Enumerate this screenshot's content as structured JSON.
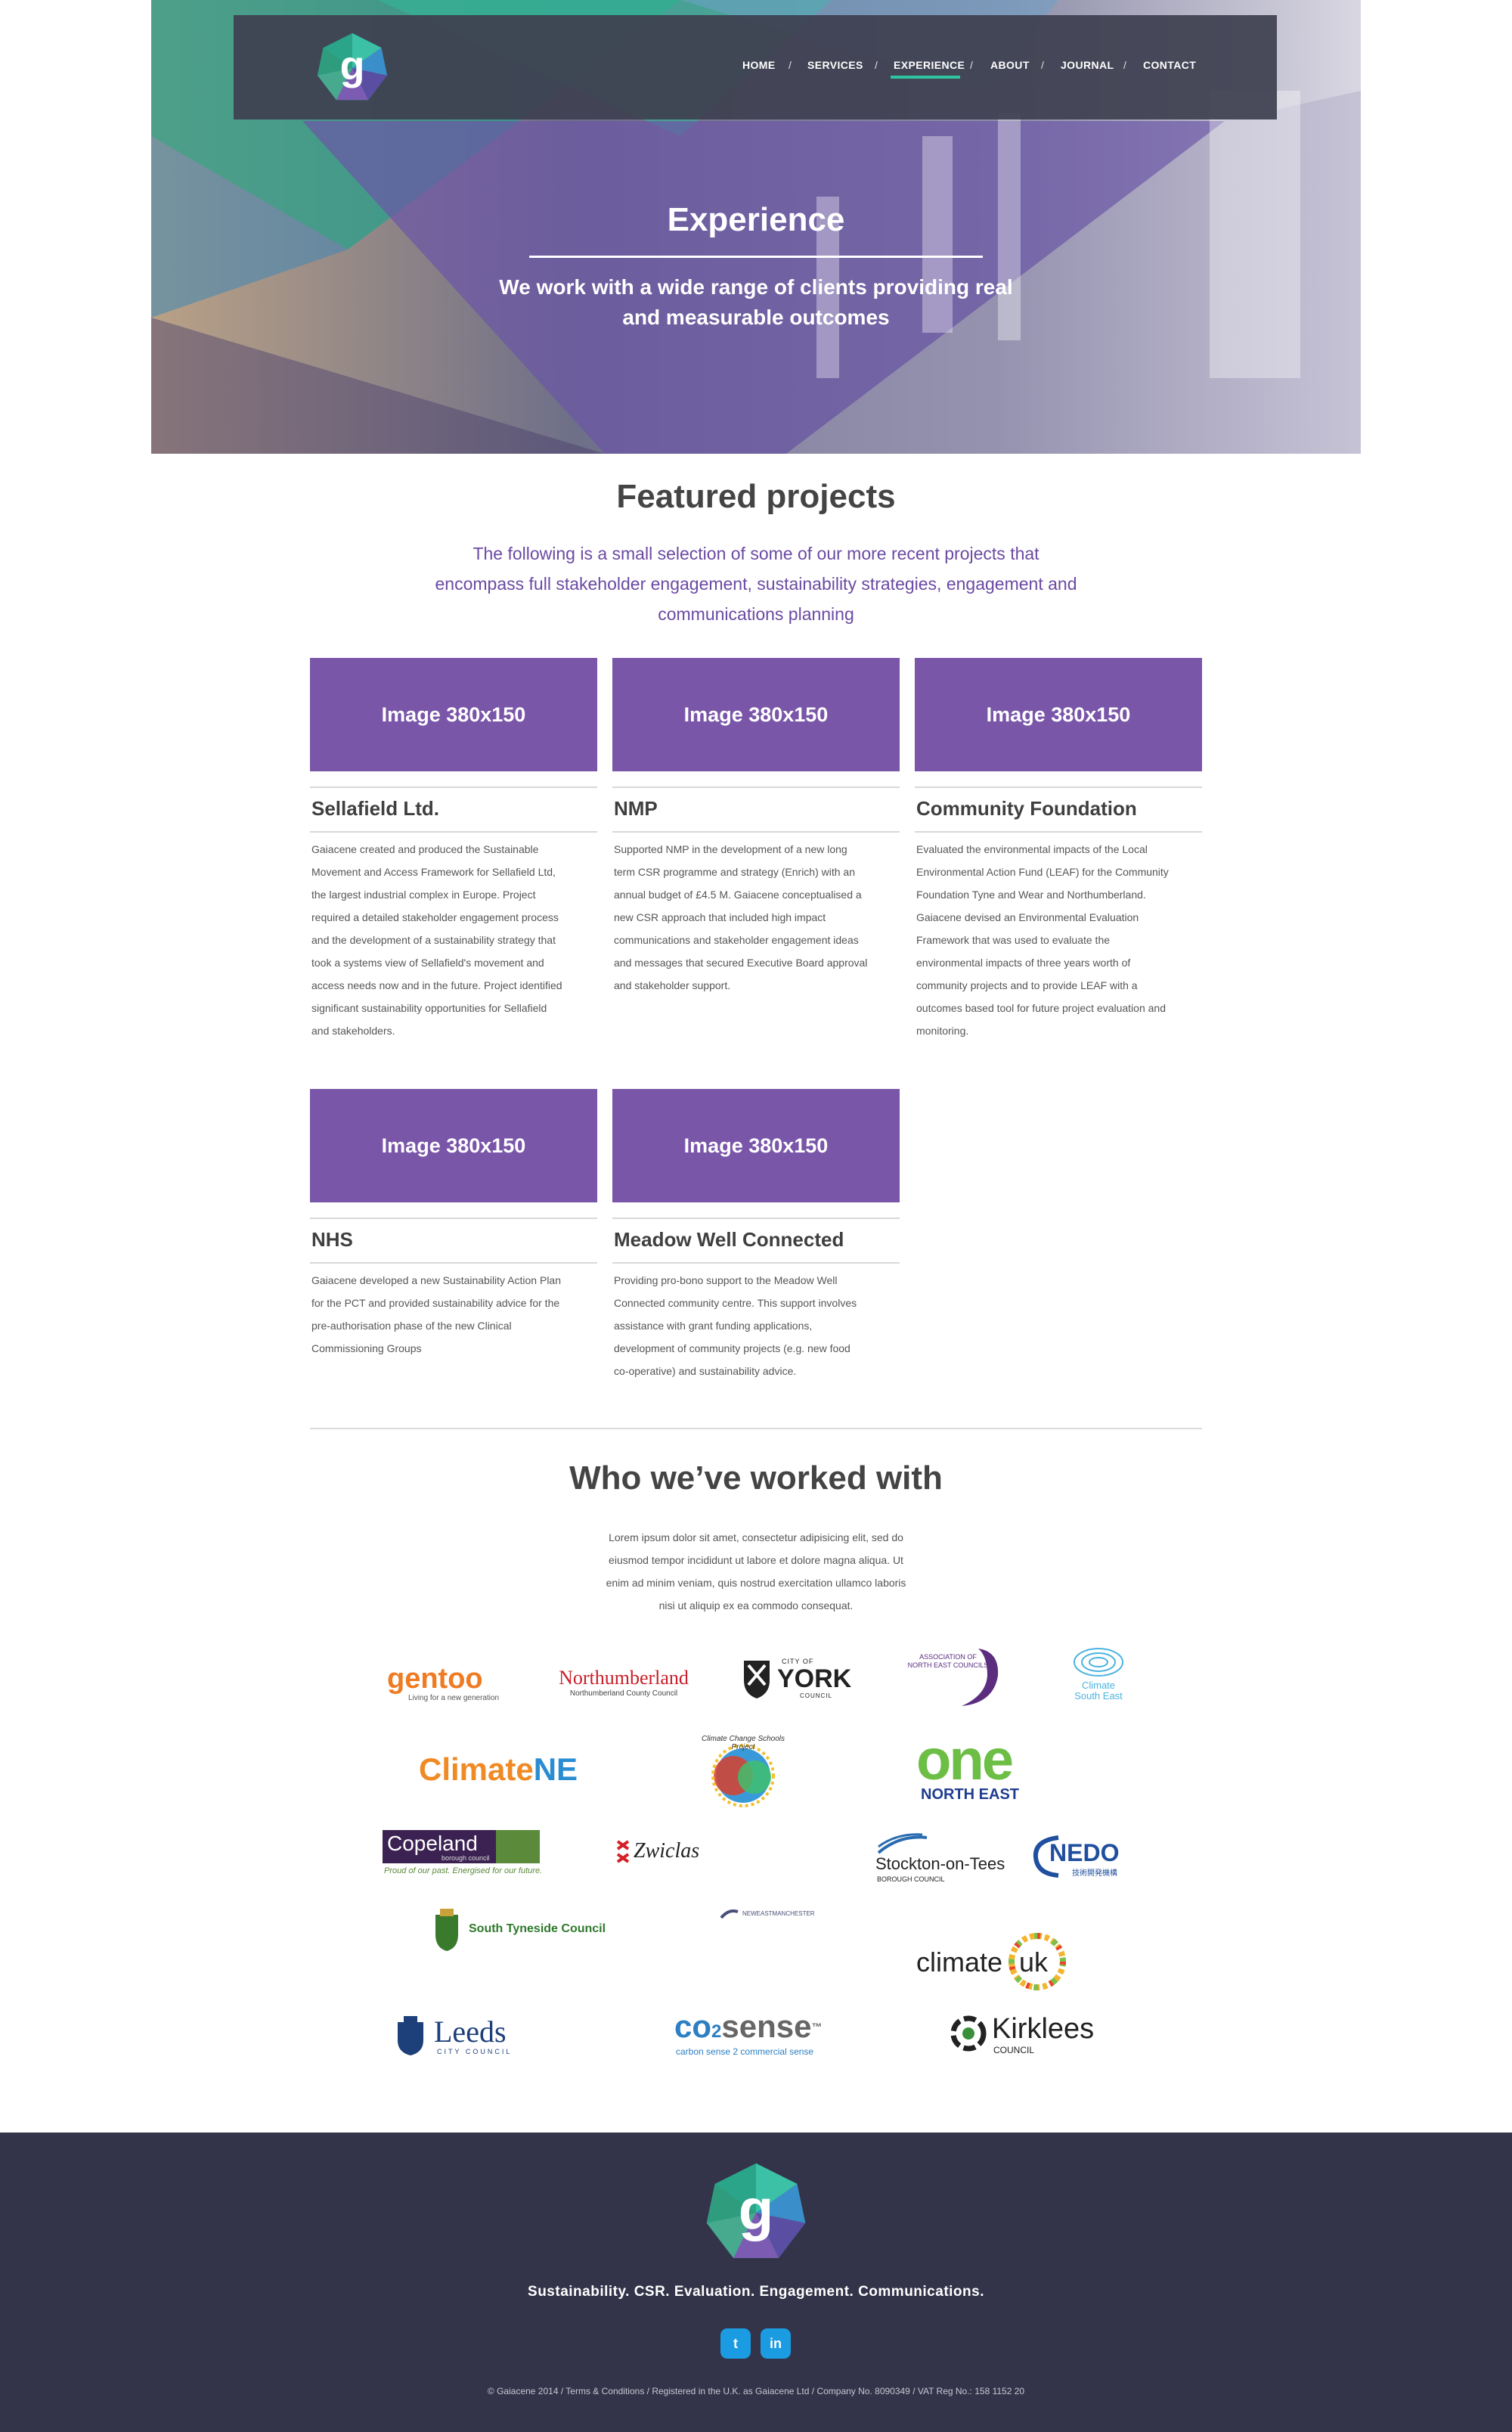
{
  "colors": {
    "brand_purple": "#7a56a9",
    "accent_teal": "#2ec4a0",
    "footer_bg": "#33344a",
    "nav_bg": "#3e3f50",
    "twitter_blue": "#1b9ce2"
  },
  "header": {
    "logo_letter": "g",
    "nav": [
      {
        "label": "HOME"
      },
      {
        "label": "SERVICES"
      },
      {
        "label": "EXPERIENCE",
        "active": true
      },
      {
        "label": "ABOUT"
      },
      {
        "label": "JOURNAL"
      },
      {
        "label": "CONTACT"
      }
    ],
    "nav_separator": "/"
  },
  "hero": {
    "title": "Experience",
    "subtitle_line1": "We work with a wide range of clients providing real",
    "subtitle_line2": "and measurable outcomes"
  },
  "featured": {
    "title": "Featured projects",
    "intro_line1": "The following is a small selection of some of our more recent projects that",
    "intro_line2": "encompass full stakeholder engagement, sustainability strategies, engagement and",
    "intro_line3": "communications planning",
    "projects": [
      {
        "image_label": "Image 380x150",
        "title": "Sellafield Ltd.",
        "text": [
          "Gaiacene created and produced the Sustainable",
          "Movement and Access Framework for Sellafield Ltd,",
          "the largest industrial complex in Europe. Project",
          "required a detailed stakeholder engagement process",
          "and the development of a sustainability strategy that",
          "took a systems view of Sellafield's movement and",
          "access needs now and in the future. Project identified",
          "significant sustainability opportunities for Sellafield",
          "and stakeholders."
        ]
      },
      {
        "image_label": "Image 380x150",
        "title": "NMP",
        "text": [
          "Supported NMP in the development of a new long",
          "term CSR programme and strategy (Enrich) with an",
          "annual budget of £4.5 M. Gaiacene conceptualised a",
          "new CSR approach that included high impact",
          "communications and stakeholder engagement ideas",
          "and messages that secured Executive Board approval",
          "and stakeholder support."
        ]
      },
      {
        "image_label": "Image 380x150",
        "title": "Community Foundation",
        "text": [
          "Evaluated the environmental impacts of the Local",
          "Environmental Action Fund (LEAF) for the Community",
          "Foundation Tyne and Wear and Northumberland.",
          "Gaiacene devised an Environmental Evaluation",
          "Framework that was used to evaluate the",
          "environmental impacts of three years worth of",
          "community projects and to provide LEAF with a",
          "outcomes based tool for future project evaluation and",
          "monitoring."
        ]
      },
      {
        "image_label": "Image 380x150",
        "title": "NHS",
        "text": [
          "Gaiacene developed a new Sustainability Action Plan",
          "for the PCT and provided sustainability advice for the",
          "pre-authorisation phase of the new Clinical",
          "Commissioning Groups"
        ]
      },
      {
        "image_label": "Image 380x150",
        "title": "Meadow Well Connected",
        "text": [
          "Providing pro-bono support to the Meadow Well",
          "Connected community centre. This support involves",
          "assistance with grant funding applications,",
          "development of community projects (e.g. new food",
          "co-operative) and sustainability advice."
        ]
      }
    ]
  },
  "clients": {
    "title": "Who we’ve worked with",
    "text": [
      "Lorem ipsum dolor sit amet, consectetur adipisicing elit, sed do",
      "eiusmod tempor incididunt ut labore et dolore magna aliqua. Ut",
      "enim ad minim veniam, quis nostrud exercitation ullamco laboris",
      "nisi ut aliquip ex ea commodo consequat."
    ],
    "logos": {
      "gentoo": {
        "word": "gentoo",
        "tag": "Living for a new generation"
      },
      "northumberland": {
        "word": "Northumberland",
        "tag": "Northumberland County Council"
      },
      "york": {
        "small": "CITY OF",
        "word": "YORK",
        "tag": "COUNCIL"
      },
      "anec": {
        "line1": "ASSOCIATION OF",
        "line2": "NORTH EAST COUNCILS"
      },
      "climate_se": {
        "line1": "Climate",
        "line2": "South East"
      },
      "climatene": {
        "part1": "Climate",
        "part2": "NE"
      },
      "schools": {
        "word": "Climate Change Schools Project"
      },
      "one_ne": {
        "word": "one",
        "tag": "NORTH EAST"
      },
      "copeland": {
        "word": "Copeland",
        "small": "borough council",
        "tag": "Proud of our past. Energised for our future."
      },
      "zwiclas": {
        "word": "Zwiclas"
      },
      "stockton": {
        "word": "Stockton-on-Tees",
        "tag": "BOROUGH COUNCIL"
      },
      "nedo": {
        "word": "NEDO",
        "tag": "技術開発機構"
      },
      "south_tyneside": {
        "word": "South Tyneside Council"
      },
      "new_east_manchester": {
        "word": "NEWEASTMANCHESTER"
      },
      "climate_uk": {
        "word": "climate",
        "word2": "uk"
      },
      "leeds": {
        "word": "Leeds",
        "tag": "CITY COUNCIL"
      },
      "co2sense": {
        "word_a": "co",
        "sub": "2",
        "word_b": "sense",
        "tm": "™",
        "tag": "carbon sense 2 commercial sense"
      },
      "kirklees": {
        "word": "Kirklees",
        "tag": "COUNCIL"
      }
    }
  },
  "footer": {
    "logo_letter": "g",
    "tagline": "Sustainability. CSR. Evaluation. Engagement. Communications.",
    "social": [
      {
        "icon": "twitter-icon",
        "glyph": "t"
      },
      {
        "icon": "linkedin-icon",
        "glyph": "in"
      }
    ],
    "copyright": "© Gaiacene 2014   /   Terms & Conditions /  Registered in the U.K. as Gaiacene Ltd  /  Company No. 8090349 / VAT Reg No.: 158 1152 20"
  }
}
